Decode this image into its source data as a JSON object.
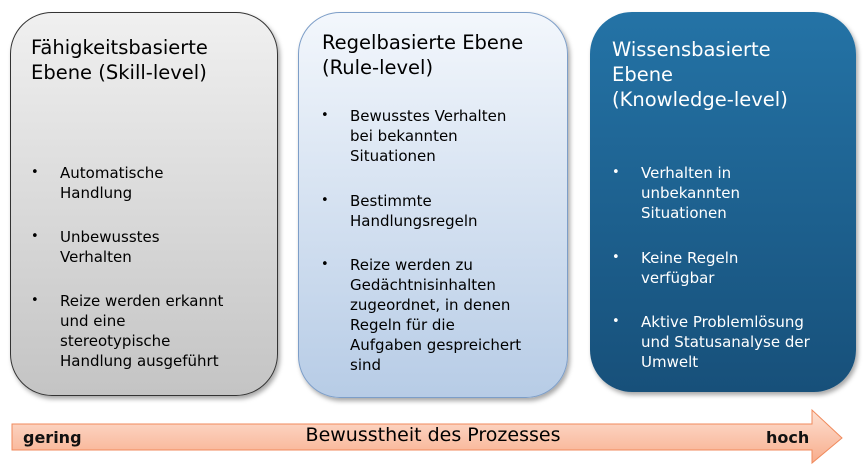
{
  "boxes": [
    {
      "title": "Fähigkeitsbasierte\nEbene (Skill-level)",
      "items": [
        "Automatische\nHandlung",
        "Unbewusstes\nVerhalten",
        "Reize werden erkannt\nund eine\nstereotypische\nHandlung ausgeführt"
      ]
    },
    {
      "title": "Regelbasierte Ebene\n(Rule-level)",
      "items": [
        "Bewusstes Verhalten\nbei bekannten\nSituationen",
        "Bestimmte\nHandlungsregeln",
        "Reize werden zu\nGedächtnisinhalten\nzugeordnet, in denen\nRegeln für die\nAufgaben gespreichert\nsind"
      ]
    },
    {
      "title": "Wissensbasierte\nEbene\n(Knowledge-level)",
      "items": [
        "Verhalten in\nunbekannten\nSituationen",
        "Keine Regeln\nverfügbar",
        "Aktive Problemlösung\nund Statusanalyse der\nUmwelt"
      ]
    }
  ],
  "arrow": {
    "left_label": "gering",
    "center_label": "Bewusstheit des Prozesses",
    "right_label": "hoch"
  },
  "colors": {
    "skill": "#d9d9d9",
    "rule": "#c9d9ee",
    "knowledge": "#1f6497",
    "arrow": "#f9b9a0"
  }
}
